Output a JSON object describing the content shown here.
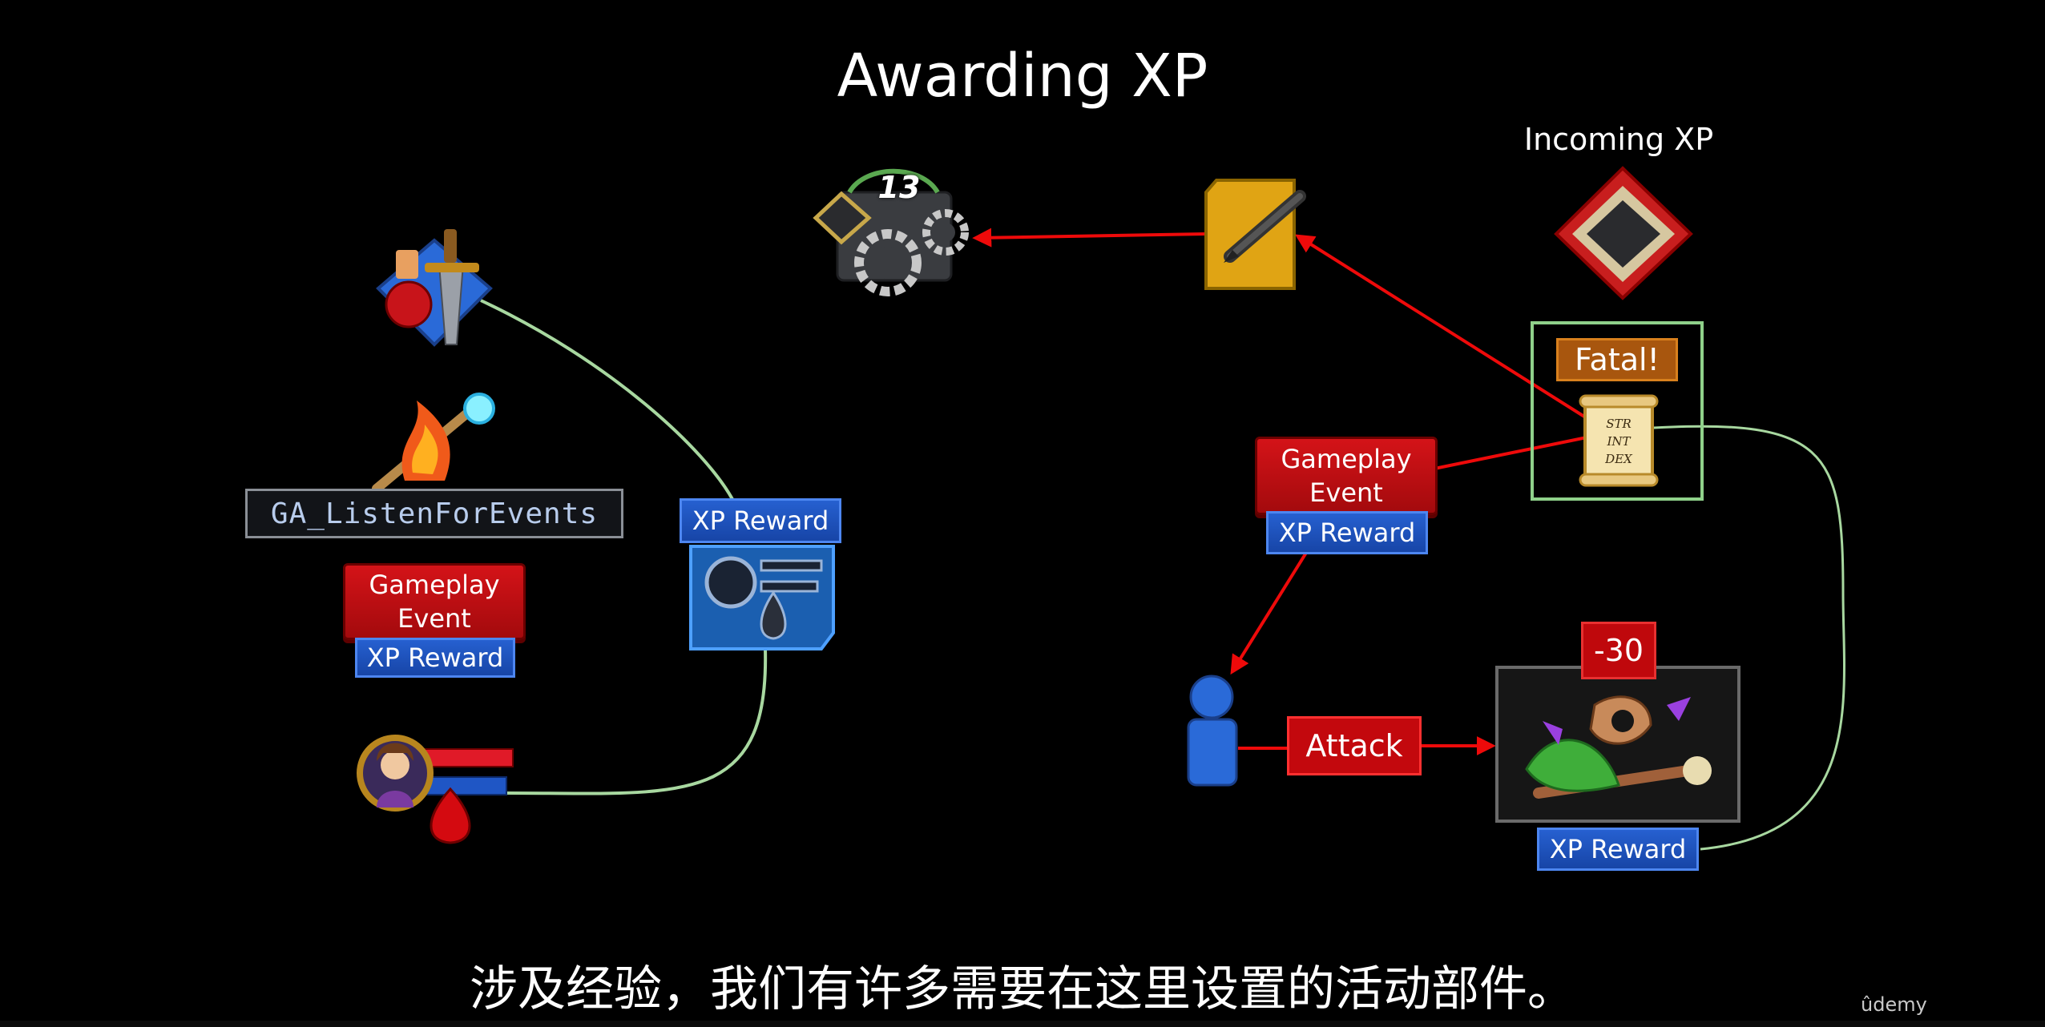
{
  "title": "Awarding XP",
  "incoming_label": "Incoming XP",
  "left": {
    "ability_name": "GA_ListenForEvents",
    "gameplay_event_label": "Gameplay\nEvent",
    "xp_reward_label": "XP Reward",
    "xp_reward_node_label": "XP Reward"
  },
  "right": {
    "fatal_label": "Fatal!",
    "scroll_lines": [
      "STR",
      "INT",
      "DEX"
    ],
    "gameplay_event_label": "Gameplay\nEvent",
    "xp_reward_label": "XP Reward",
    "attack_label": "Attack",
    "damage_label": "-30",
    "enemy_xp_reward_label": "XP Reward"
  },
  "level_badge": "13",
  "subtitle": "涉及经验，我们有许多需要在这里设置的活动部件。",
  "watermark": "ûdemy",
  "colors": {
    "connector_green": "#a8d8a0",
    "arrow_red": "#ee0a0a",
    "event_red": "#c10e12",
    "reward_blue": "#1f56c5",
    "fatal_orange": "#a8560e"
  }
}
